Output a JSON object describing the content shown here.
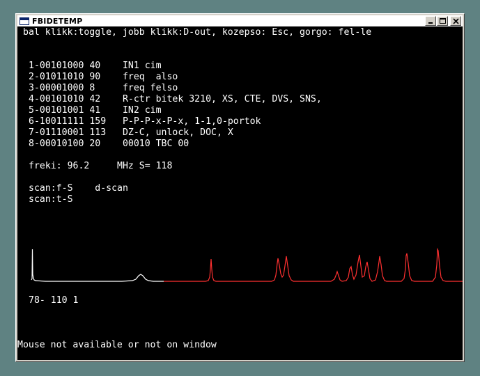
{
  "window": {
    "title": "FBIDETEMP"
  },
  "console": {
    "header": "bal klikk:toggle, jobb klikk:D-out, kozepso: Esc, gorgo: fel-le",
    "registers": [
      "1-00101000 40    IN1 cim",
      "2-01011010 90    freq  also",
      "3-00001000 8     freq felso",
      "4-00101010 42    R-ctr bitek 3210, XS, CTE, DVS, SNS,",
      "5-00101001 41    IN2 cim",
      "6-10011111 159   P-P-P-x-P-x, 1-1,0-portok",
      "7-01110001 113   DZ-C, unlock, DOC, X",
      "8-00010100 20    00010 TBC 00"
    ],
    "freq_line": "freki: 96.2     MHz S= 118",
    "scan_line1": "scan:f-S    d-scan",
    "scan_line2": "scan:t-S",
    "bottom_line": "78- 110 1",
    "mouse_status": "Mouse not available or not on window"
  },
  "colors": {
    "desktop": "#5f8282",
    "console_bg": "#000000",
    "console_text": "#ffffff",
    "trace_white": "#ffffff",
    "trace_red": "#ff3030"
  },
  "icons": {
    "app": "console-app-icon",
    "minimize": "minimize-icon",
    "maximize": "maximize-icon",
    "close": "close-icon"
  }
}
